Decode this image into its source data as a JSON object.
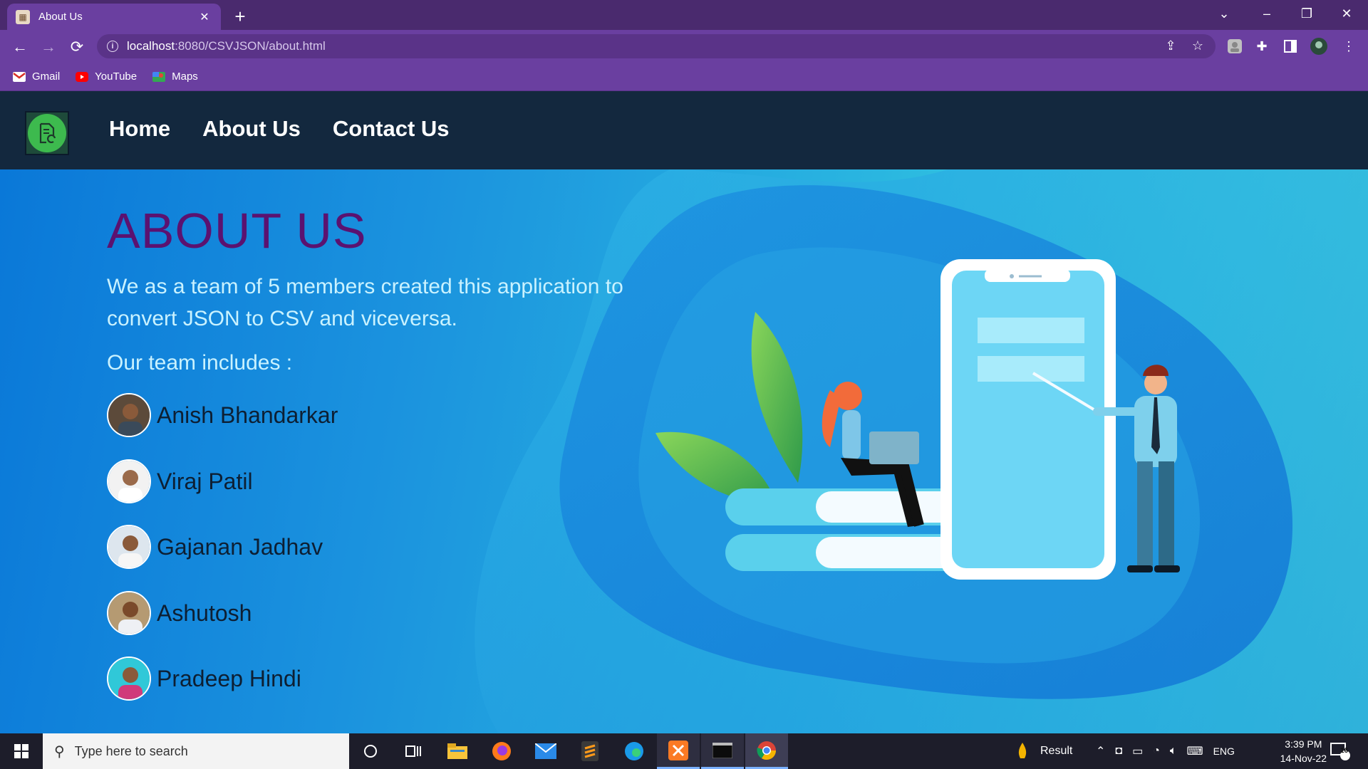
{
  "browser": {
    "tab_title": "About Us",
    "url_host": "localhost",
    "url_path": ":8080/CSVJSON/about.html",
    "bookmarks": [
      {
        "label": "Gmail",
        "icon": "gmail-icon"
      },
      {
        "label": "YouTube",
        "icon": "youtube-icon"
      },
      {
        "label": "Maps",
        "icon": "maps-icon"
      }
    ]
  },
  "site": {
    "nav": [
      "Home",
      "About Us",
      "Contact Us"
    ],
    "logo_icon": "document-convert-icon"
  },
  "hero": {
    "title": "ABOUT US",
    "description": "We as a team of 5 members created this application to convert JSON to CSV and viceversa.",
    "team_heading": "Our team includes :",
    "members": [
      "Anish Bhandarkar",
      "Viraj Patil",
      "Gajanan Jadhav",
      "Ashutosh",
      "Pradeep Hindi"
    ]
  },
  "taskbar": {
    "search_placeholder": "Type here to search",
    "tray_app_label": "Result",
    "language": "ENG",
    "time": "3:39 PM",
    "date": "14-Nov-22",
    "notification_count": "16"
  },
  "colors": {
    "browser_frame": "#6a3fa0",
    "site_nav_bg": "#13283e",
    "hero_title": "#5b1270",
    "hero_text": "#c9f2ff",
    "logo_green": "#3dba4e"
  }
}
